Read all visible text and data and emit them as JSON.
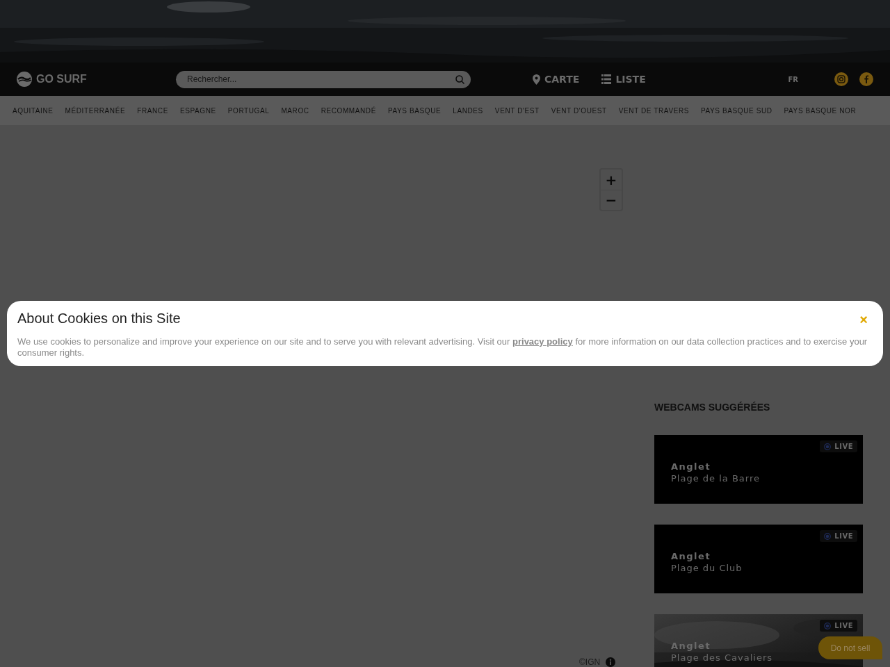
{
  "header": {
    "logo": "GO SURF",
    "search": {
      "placeholder": "Rechercher..."
    },
    "views": [
      {
        "label": "CARTE",
        "kind": "map",
        "selected": false
      },
      {
        "label": "LISTE",
        "kind": "list",
        "selected": false
      }
    ],
    "language": "FR",
    "social": [
      {
        "kind": "instagram"
      },
      {
        "kind": "facebook"
      }
    ]
  },
  "categories": [
    "AQUITAINE",
    "MÉDITERRANÉE",
    "FRANCE",
    "ESPAGNE",
    "PORTUGAL",
    "MAROC",
    "RECOMMANDÉ",
    "PAYS BASQUE",
    "LANDES",
    "VENT D'EST",
    "VENT D'OUEST",
    "VENT DE TRAVERS",
    "PAYS BASQUE SUD",
    "PAYS BASQUE NOR"
  ],
  "map": {
    "zoom_in": "+",
    "zoom_out": "−",
    "attribution": "©IGN"
  },
  "sidebar": {
    "title": "WEBCAMS SUGGÉRÉES",
    "webcams": [
      {
        "city": "Anglet",
        "beach": "Plage de la Barre",
        "badge": "LIVE",
        "kind": "dark"
      },
      {
        "city": "Anglet",
        "beach": "Plage du Club",
        "badge": "LIVE",
        "kind": "dark"
      },
      {
        "city": "Anglet",
        "beach": "Plage des Cavaliers",
        "badge": "LIVE",
        "kind": "picture"
      }
    ]
  },
  "cookie_banner": {
    "title": "About Cookies on this Site",
    "text_before": "We use cookies to personalize and improve your experience on our site and to serve you with relevant advertising. Visit our",
    "link": "privacy policy",
    "text_after": "for more information on our data collection practices and to exercise your consumer rights.",
    "close": "×"
  },
  "do_not_sell": "Do not sell"
}
